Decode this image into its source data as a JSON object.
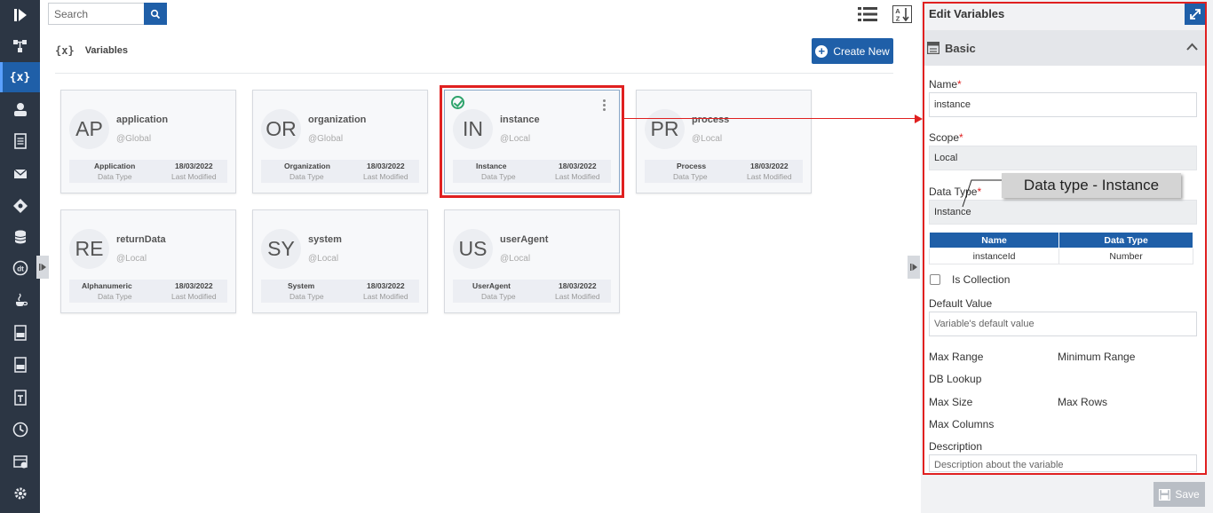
{
  "search": {
    "placeholder": "Search"
  },
  "header": {
    "title_icon": "{x}",
    "title": "Variables",
    "create_new_label": "Create New"
  },
  "rail": {
    "items": [
      {
        "icon": "play-logo-icon"
      },
      {
        "icon": "process-flow-icon"
      },
      {
        "icon": "variables-icon",
        "glyph": "{x}",
        "active": true
      },
      {
        "icon": "user-icon"
      },
      {
        "icon": "document-icon"
      },
      {
        "icon": "mail-icon"
      },
      {
        "icon": "gateway-icon"
      },
      {
        "icon": "database-icon"
      },
      {
        "icon": "datatype-icon"
      },
      {
        "icon": "java-icon"
      },
      {
        "icon": "xml-file-icon"
      },
      {
        "icon": "csv-file-icon"
      },
      {
        "icon": "text-file-icon"
      },
      {
        "icon": "clock-icon"
      },
      {
        "icon": "scheduler-icon"
      },
      {
        "icon": "settings-gear-icon"
      }
    ]
  },
  "cards": [
    {
      "initials": "AP",
      "name": "application",
      "scope": "@Global",
      "data_type": "Application",
      "data_type_label": "Data Type",
      "modified": "18/03/2022",
      "modified_label": "Last Modified"
    },
    {
      "initials": "OR",
      "name": "organization",
      "scope": "@Global",
      "data_type": "Organization",
      "data_type_label": "Data Type",
      "modified": "18/03/2022",
      "modified_label": "Last Modified"
    },
    {
      "initials": "IN",
      "name": "instance",
      "scope": "@Local",
      "data_type": "Instance",
      "data_type_label": "Data Type",
      "modified": "18/03/2022",
      "modified_label": "Last Modified",
      "selected": true
    },
    {
      "initials": "PR",
      "name": "process",
      "scope": "@Local",
      "data_type": "Process",
      "data_type_label": "Data Type",
      "modified": "18/03/2022",
      "modified_label": "Last Modified"
    },
    {
      "initials": "RE",
      "name": "returnData",
      "scope": "@Local",
      "data_type": "Alphanumeric",
      "data_type_label": "Data Type",
      "modified": "18/03/2022",
      "modified_label": "Last Modified"
    },
    {
      "initials": "SY",
      "name": "system",
      "scope": "@Local",
      "data_type": "System",
      "data_type_label": "Data Type",
      "modified": "18/03/2022",
      "modified_label": "Last Modified"
    },
    {
      "initials": "US",
      "name": "userAgent",
      "scope": "@Local",
      "data_type": "UserAgent",
      "data_type_label": "Data Type",
      "modified": "18/03/2022",
      "modified_label": "Last Modified"
    }
  ],
  "panel": {
    "title": "Edit Variables",
    "section": "Basic",
    "name_label": "Name",
    "name_value": "instance",
    "scope_label": "Scope",
    "scope_value": "Local",
    "data_type_label": "Data Type",
    "data_type_value": "Instance",
    "table": {
      "headers": [
        "Name",
        "Data Type"
      ],
      "rows": [
        [
          "instanceId",
          "Number"
        ]
      ]
    },
    "is_collection_label": "Is Collection",
    "default_value_label": "Default Value",
    "default_value_placeholder": "Variable's default value",
    "max_range_label": "Max Range",
    "minimum_range_label": "Minimum Range",
    "db_lookup_label": "DB Lookup",
    "max_size_label": "Max Size",
    "max_rows_label": "Max Rows",
    "max_columns_label": "Max Columns",
    "description_label": "Description",
    "description_placeholder": "Description about the variable",
    "save_label": "Save"
  },
  "annotation": {
    "callout": "Data type - Instance",
    "color": "#e02020"
  },
  "colors": {
    "primary": "#1f5fa8",
    "rail": "#2c3644",
    "highlight": "#e02020",
    "success": "#2ea36b"
  }
}
